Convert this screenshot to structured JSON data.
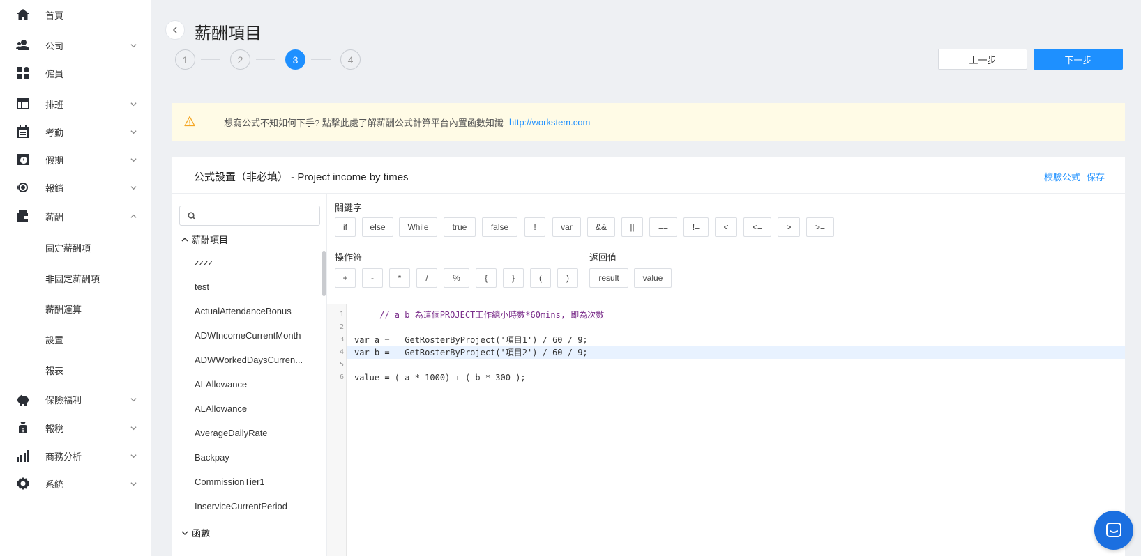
{
  "sidebar": {
    "items": [
      {
        "label": "首頁",
        "icon": "home-icon",
        "expandable": false
      },
      {
        "label": "公司",
        "icon": "users-icon",
        "expandable": true
      },
      {
        "label": "僱員",
        "icon": "grid-icon",
        "expandable": false
      },
      {
        "label": "排班",
        "icon": "table-icon",
        "expandable": true
      },
      {
        "label": "考勤",
        "icon": "calendar-icon",
        "expandable": true
      },
      {
        "label": "假期",
        "icon": "clock-icon",
        "expandable": true
      },
      {
        "label": "報銷",
        "icon": "eye-icon",
        "expandable": true
      },
      {
        "label": "薪酬",
        "icon": "wallet-icon",
        "expandable": true,
        "expanded": true
      },
      {
        "label": "保險福利",
        "icon": "piggy-bank-icon",
        "expandable": true
      },
      {
        "label": "報稅",
        "icon": "money-bag-icon",
        "expandable": true
      },
      {
        "label": "商務分析",
        "icon": "bar-chart-icon",
        "expandable": true
      },
      {
        "label": "系統",
        "icon": "gear-icon",
        "expandable": true
      }
    ],
    "payroll_sub_items": [
      "固定薪酬項",
      "非固定薪酬項",
      "薪酬運算",
      "設置",
      "報表"
    ]
  },
  "header": {
    "title": "薪酬項目",
    "steps": [
      "1",
      "2",
      "3",
      "4"
    ],
    "active_step": 3,
    "prev_label": "上一步",
    "next_label": "下一步"
  },
  "alert": {
    "text": "想寫公式不知如何下手? 點擊此處了解薪酬公式計算平台內置函數知識",
    "link": "http://workstem.com"
  },
  "card": {
    "title": "公式設置（非必填） - Project income by times",
    "validate_label": "校驗公式",
    "save_label": "保存"
  },
  "left_pane": {
    "search_placeholder": "",
    "group_payroll_label": "薪酬項目",
    "items": [
      "zzzz",
      "test",
      "ActualAttendanceBonus",
      "ADWIncomeCurrentMonth",
      "ADWWorkedDaysCurren...",
      "ALAllowance",
      "ALAllowance",
      "AverageDailyRate",
      "Backpay",
      "CommissionTier1",
      "InserviceCurrentPeriod"
    ],
    "group_functions_label": "函數"
  },
  "keywords": {
    "label": "關鍵字",
    "items": [
      "if",
      "else",
      "While",
      "true",
      "false",
      "!",
      "var",
      "&&",
      "||",
      "==",
      "!=",
      "<",
      "<=",
      ">",
      ">="
    ]
  },
  "operators": {
    "label": "操作符",
    "items": [
      "+",
      "-",
      "*",
      "/",
      "%",
      "{",
      "}",
      "(",
      ")"
    ]
  },
  "return_values": {
    "label": "返回值",
    "items": [
      "result",
      "value"
    ]
  },
  "editor": {
    "line_numbers": [
      "1",
      "2",
      "3",
      "4",
      "5",
      "6"
    ],
    "active_line": 4,
    "lines": [
      "     // a b 為這個PROJECT工作總小時數*60mins, 即為次數",
      "",
      "var a =   GetRosterByProject('項目1') / 60 / 9;",
      "var b =   GetRosterByProject('項目2') / 60 / 9;",
      "",
      "value = ( a * 1000) + ( b * 300 );"
    ]
  },
  "colors": {
    "accent": "#1e90ff",
    "alert_bg": "#fffbe6",
    "code_keyword": "#7a2d8a"
  }
}
